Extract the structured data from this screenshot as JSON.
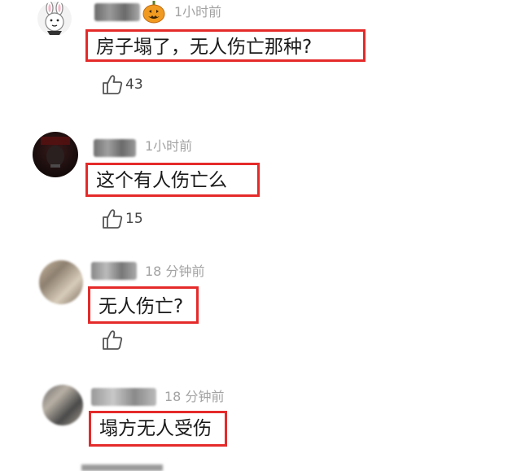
{
  "comments": [
    {
      "time": "1小时前",
      "text": "房子塌了，无人伤亡那种?",
      "likes": "43"
    },
    {
      "time": "1小时前",
      "text": "这个有人伤亡么",
      "likes": "15"
    },
    {
      "time": "18 分钟前",
      "text": "无人伤亡?",
      "likes": ""
    },
    {
      "time": "18 分钟前",
      "text": "塌方无人受伤",
      "likes": ""
    }
  ],
  "colors": {
    "highlight_border": "#e52a2a",
    "timestamp": "#a3a3a3"
  },
  "icons": {
    "like": "thumbs-up-icon",
    "avatar_1": "bunny-avatar",
    "badge_1": "pumpkin-icon"
  }
}
